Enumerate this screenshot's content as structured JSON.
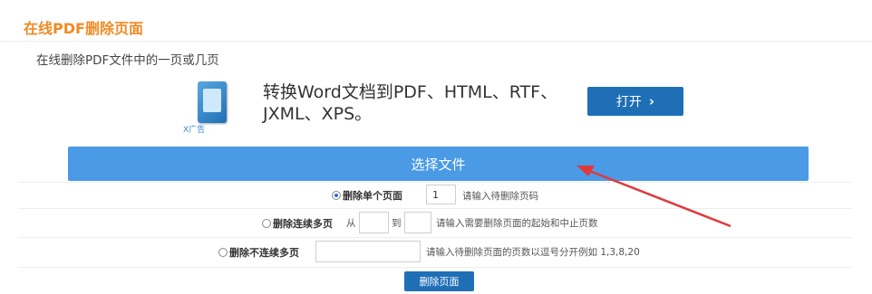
{
  "header": {
    "title": "在线PDF删除页面",
    "subtitle": "在线删除PDF文件中的一页或几页"
  },
  "ad": {
    "text": "转换Word文档到PDF、HTML、RTF、JXML、XPS。",
    "badge": "X广告",
    "button_label": "打开",
    "icon": "book-icon"
  },
  "choose_file_label": "选择文件",
  "options": {
    "single": {
      "label": "删除单个页面",
      "value": "1",
      "hint": "请输入待删除页码",
      "selected": true
    },
    "range": {
      "label": "删除连续多页",
      "from_label": "从",
      "to_label": "到",
      "from_value": "",
      "to_value": "",
      "hint": "请输入需要删除页面的起始和中止页数",
      "selected": false
    },
    "list": {
      "label": "删除不连续多页",
      "value": "",
      "hint": "请输入待删除页面的页数以逗号分开例如 1,3,8,20",
      "selected": false
    }
  },
  "delete_button_label": "删除页面",
  "colors": {
    "title": "#f08a24",
    "primary": "#4a9ae6",
    "dark_button": "#1f6fb6",
    "annotation_arrow": "#e0393b"
  }
}
